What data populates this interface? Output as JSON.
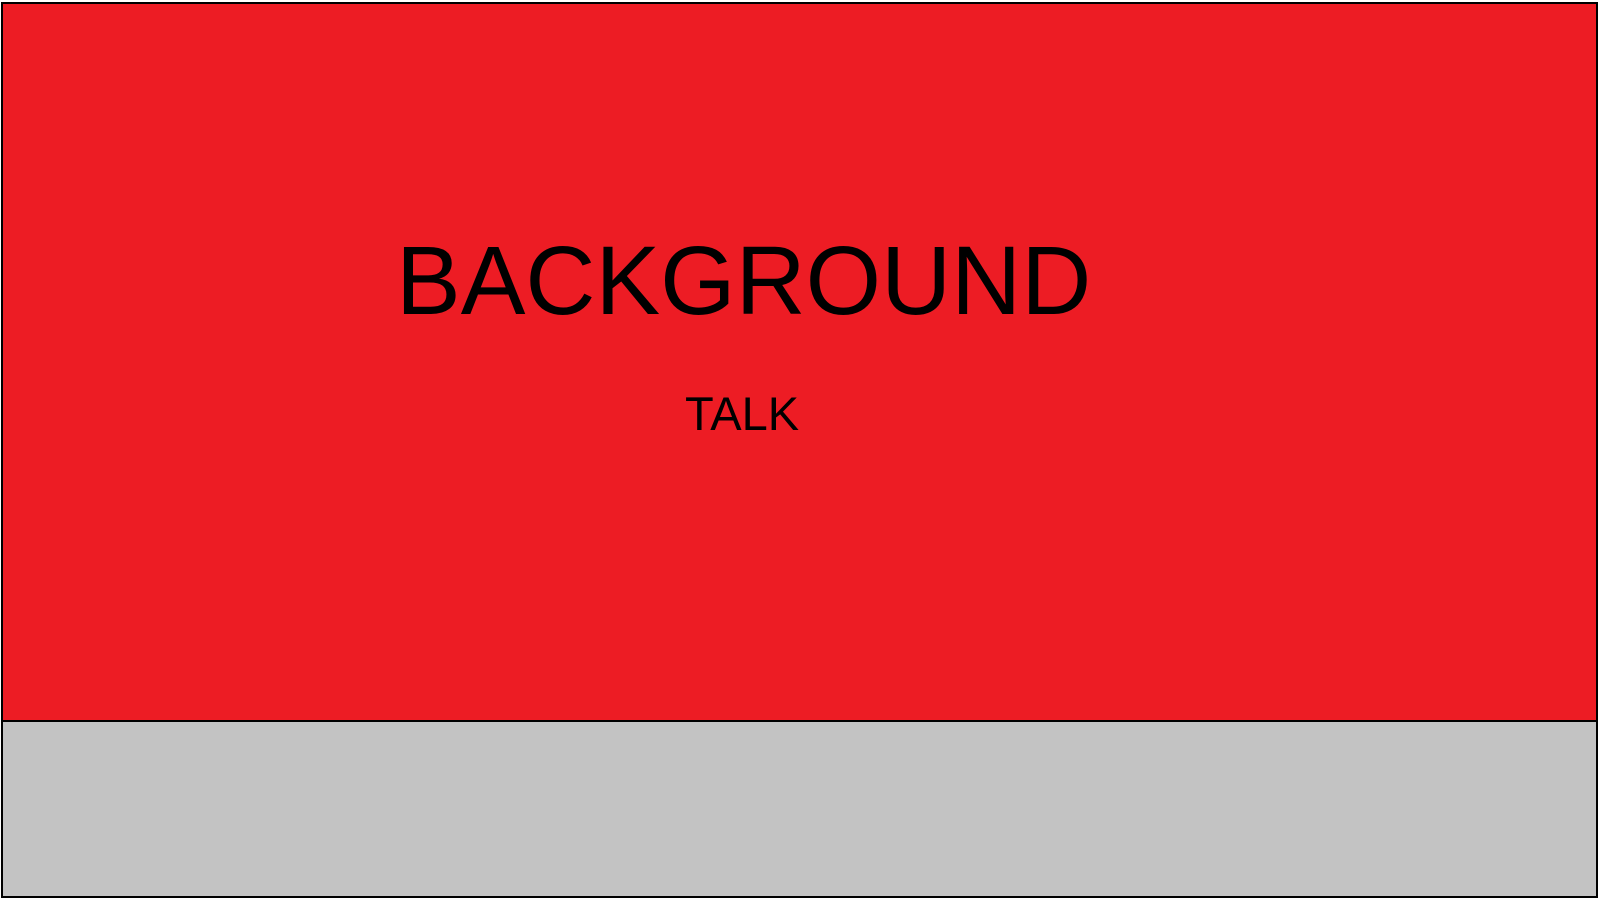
{
  "screen": {
    "title": "BACKGROUND",
    "subtitle": "TALK"
  },
  "colors": {
    "background_panel": "#ed1c24",
    "bottom_panel": "#c3c3c3",
    "text": "#000000",
    "border": "#000000"
  }
}
